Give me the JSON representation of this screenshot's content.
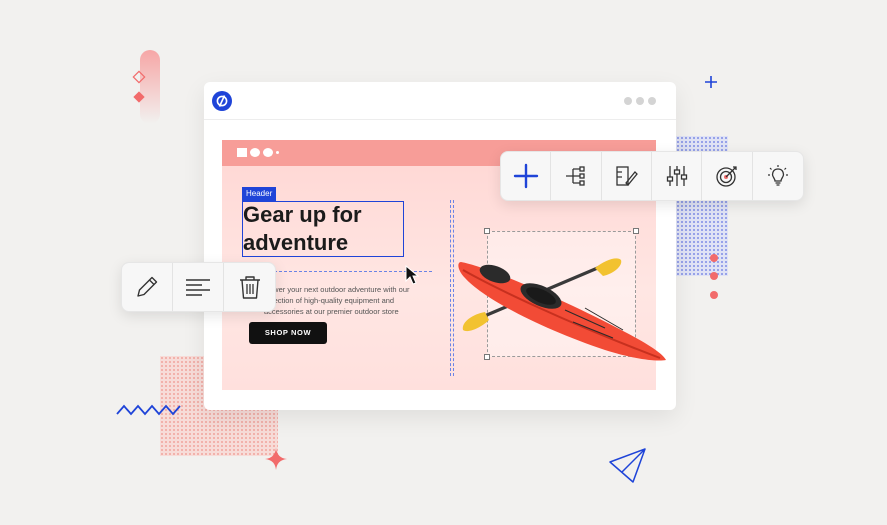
{
  "canvas": {
    "header_tag": "Header",
    "headline": "Gear up for adventure",
    "body_text": "Power your next outdoor adventure with our selection of high-quality equipment and accessories at our premier outdoor store",
    "cta_label": "SHOP NOW"
  },
  "toolbar_top": {
    "tools": [
      "add-icon",
      "sitemap-icon",
      "design-icon",
      "sliders-icon",
      "target-icon",
      "lightbulb-icon"
    ]
  },
  "toolbar_left": {
    "tools": [
      "pencil-icon",
      "align-text-icon",
      "trash-icon"
    ]
  },
  "colors": {
    "accent_blue": "#1f44d8",
    "canvas_pink": "#ffd6d3",
    "header_pink": "#f79d98",
    "kayak_red": "#f24b36",
    "paddle_yellow": "#f2c230"
  }
}
